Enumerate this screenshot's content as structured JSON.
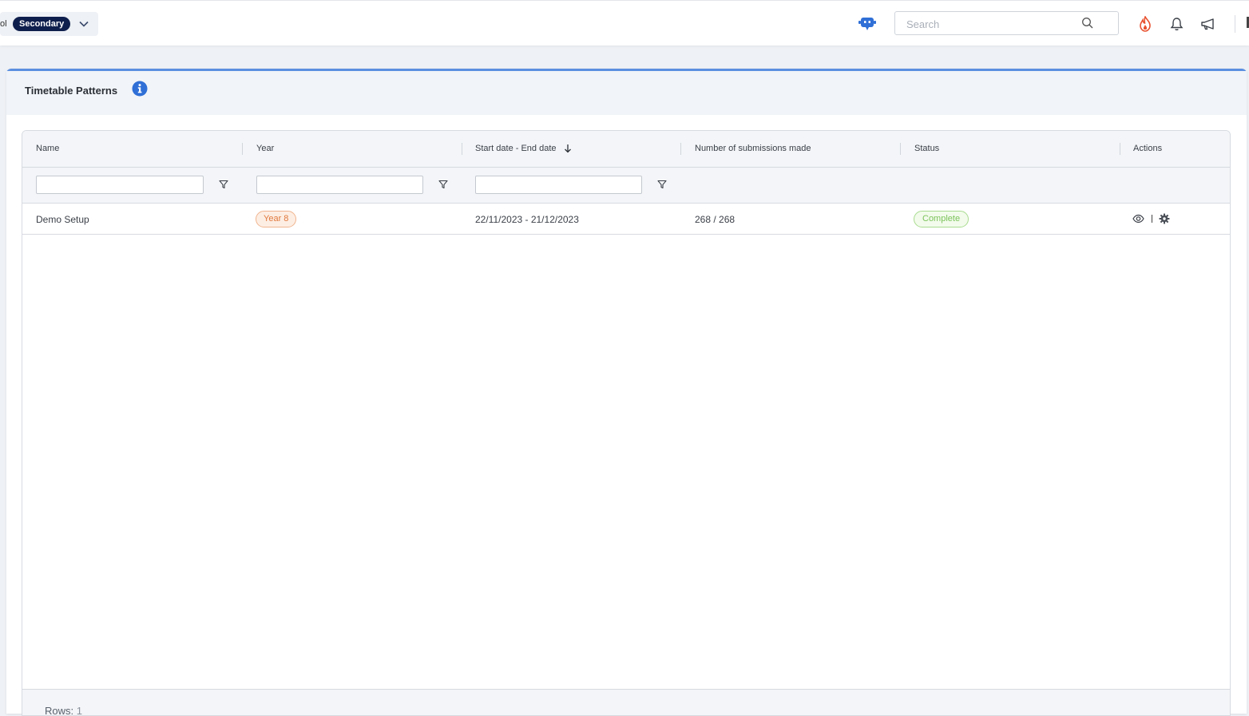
{
  "topbar": {
    "school_prefix": "ol",
    "school_type": "Secondary",
    "search_placeholder": "Search"
  },
  "panel": {
    "title": "Timetable Patterns"
  },
  "table": {
    "columns": [
      "Name",
      "Year",
      "Start date - End date",
      "Number of submissions made",
      "Status",
      "Actions"
    ],
    "rows": [
      {
        "name": "Demo Setup",
        "year": "Year 8",
        "dates": "22/11/2023 - 21/12/2023",
        "submissions": "268 / 268",
        "status": "Complete"
      }
    ],
    "footer": {
      "rows_label": "Rows:",
      "rows_count": "1"
    }
  },
  "colors": {
    "brand_navy": "#0f1f4d",
    "accent_blue": "#5b8fe0",
    "year_badge": "#e0793d",
    "status_complete": "#7cc35a",
    "fire": "#e8502e"
  },
  "icons": {
    "school_dropdown": "chevron-down-icon",
    "assistant": "chatbot-icon",
    "search": "search-icon",
    "streak": "fire-icon",
    "notifications": "bell-icon",
    "announcements": "megaphone-icon",
    "info": "info-icon",
    "sort": "sort-arrow-down-icon",
    "filter": "filter-icon",
    "view": "eye-icon",
    "settings": "gear-icon"
  }
}
